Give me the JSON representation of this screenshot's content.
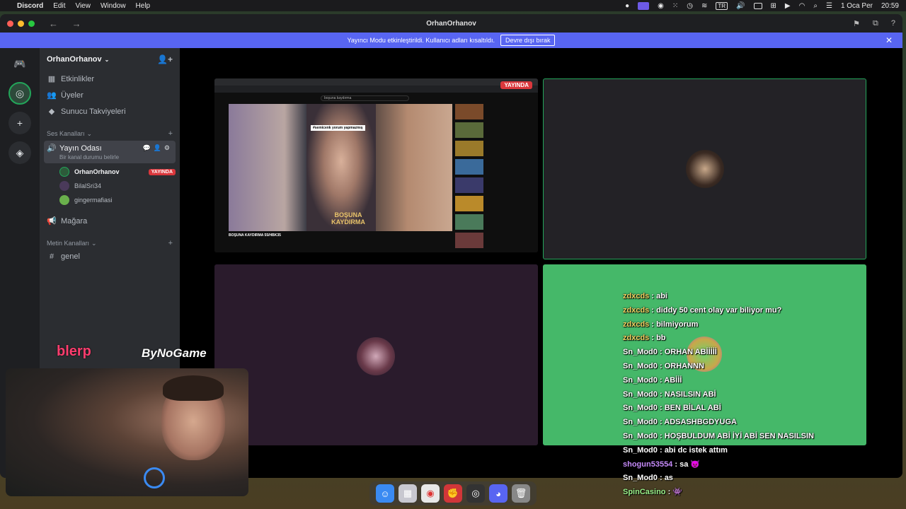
{
  "menubar": {
    "app": "Discord",
    "items": [
      "Edit",
      "View",
      "Window",
      "Help"
    ],
    "input_lang": "TR",
    "date": "1 Oca Per",
    "time": "20:59"
  },
  "window": {
    "title": "OrhanOrhanov",
    "banner_text": "Yayıncı Modu etkinleştirildi. Kullanıcı adları kısaltıldı.",
    "banner_button": "Devre dışı bırak"
  },
  "sidebar": {
    "server_name": "OrhanOrhanov",
    "items": [
      {
        "label": "Etkinlikler",
        "icon": "calendar-icon"
      },
      {
        "label": "Üyeler",
        "icon": "members-icon"
      },
      {
        "label": "Sunucu Takviyeleri",
        "icon": "boost-icon"
      }
    ],
    "voice_category": "Ses Kanalları",
    "voice_channel": {
      "name": "Yayın Odası",
      "status": "Bir kanal durumu belirle"
    },
    "voice_users": [
      {
        "name": "OrhanOrhanov",
        "live": "YAYINDA",
        "color": "#2d5a3a"
      },
      {
        "name": "BilalSri34",
        "color": "#4a3a5a"
      },
      {
        "name": "gingermafiasi",
        "color": "#6ab04c"
      }
    ],
    "stage_channel": "Mağara",
    "text_category": "Metin Kanalları",
    "text_channel": "genel"
  },
  "stage": {
    "live_label": "YAYINDA",
    "shared_screen": {
      "search_text": "boşuna kaydırma",
      "caption": "#semicenk yorum yapmazmış",
      "video_overlay": "BOŞUNA KAYDIRMA",
      "video_title": "BOŞUNA KAYDIRMA 55/HBK35"
    }
  },
  "chat": [
    {
      "user": "zdxcds",
      "text": "abi",
      "color": "yellow"
    },
    {
      "user": "zdxcds",
      "text": "diddy 50 cent olay var biliyor mu?",
      "color": "yellow"
    },
    {
      "user": "zdxcds",
      "text": "bilmiyorum",
      "color": "yellow"
    },
    {
      "user": "zdxcds",
      "text": "bb",
      "color": "yellow"
    },
    {
      "user": "Sn_Mod0",
      "text": "ORHAN ABİİİİİ",
      "color": "mod"
    },
    {
      "user": "Sn_Mod0",
      "text": "ORHANNN",
      "color": "mod"
    },
    {
      "user": "Sn_Mod0",
      "text": "ABİİİ",
      "color": "mod"
    },
    {
      "user": "Sn_Mod0",
      "text": "NASILSIN ABİ",
      "color": "mod"
    },
    {
      "user": "Sn_Mod0",
      "text": "BEN BİLAL ABİ",
      "color": "mod"
    },
    {
      "user": "Sn_Mod0",
      "text": "ADSASHBGDYUGA",
      "color": "mod"
    },
    {
      "user": "Sn_Mod0",
      "text": "HOŞBULDUM ABİ İYİ ABİ SEN NASILSIN",
      "color": "mod"
    },
    {
      "user": "Sn_Mod0",
      "text": "abi dc istek attım",
      "color": "mod"
    },
    {
      "user": "shogun53554",
      "text": "sa",
      "color": "pur"
    },
    {
      "user": "Sn_Mod0",
      "text": "as",
      "color": "mod"
    },
    {
      "user": "SpinCasino",
      "text": "",
      "color": "grn"
    }
  ],
  "overlays": {
    "sponsor1": "blerp",
    "sponsor2": "ByNoGame"
  },
  "dock": [
    "finder-icon",
    "launchpad-icon",
    "chrome-icon",
    "riot-icon",
    "obs-icon",
    "discord-icon",
    "trash-icon"
  ]
}
